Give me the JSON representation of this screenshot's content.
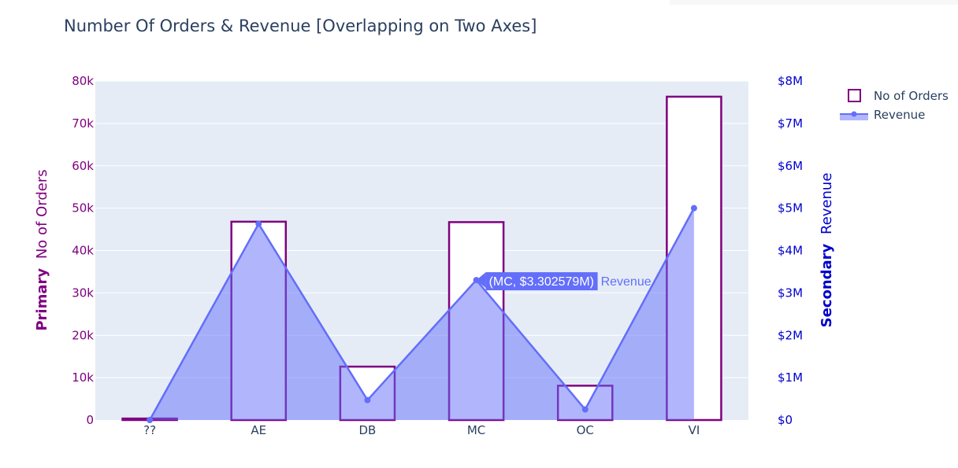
{
  "chart_data": {
    "type": "bar+area",
    "title": "Number Of Orders & Revenue [Overlapping on Two Axes]",
    "categories": [
      "??",
      "AE",
      "DB",
      "MC",
      "OC",
      "VI"
    ],
    "primary_axis": {
      "label_bold": "Primary",
      "label_rest": "No of Orders",
      "ylim": [
        0,
        80000
      ],
      "ticks": [
        0,
        10000,
        20000,
        30000,
        40000,
        50000,
        60000,
        70000,
        80000
      ],
      "tick_labels": [
        "0",
        "10k",
        "20k",
        "30k",
        "40k",
        "50k",
        "60k",
        "70k",
        "80k"
      ],
      "color": "#800080"
    },
    "secondary_axis": {
      "label_bold": "Secondary",
      "label_rest": "Revenue",
      "ylim": [
        0,
        8000000
      ],
      "ticks": [
        0,
        1000000,
        2000000,
        3000000,
        4000000,
        5000000,
        6000000,
        7000000,
        8000000
      ],
      "tick_labels": [
        "$0",
        "$1M",
        "$2M",
        "$3M",
        "$4M",
        "$5M",
        "$6M",
        "$7M",
        "$8M"
      ],
      "color": "#0000cc"
    },
    "series": [
      {
        "name": "No of Orders",
        "type": "bar",
        "axis": "primary",
        "values": [
          350,
          46800,
          12600,
          46700,
          8100,
          76300
        ],
        "color": "#800080"
      },
      {
        "name": "Revenue",
        "type": "area",
        "axis": "secondary",
        "values": [
          0,
          4630000,
          470000,
          3302579,
          250000,
          5000000
        ],
        "color": "#636efa"
      }
    ],
    "hover": {
      "category": "MC",
      "text": "(MC, $3.302579M)",
      "series": "Revenue"
    },
    "grid": true,
    "legend_position": "top-right"
  }
}
